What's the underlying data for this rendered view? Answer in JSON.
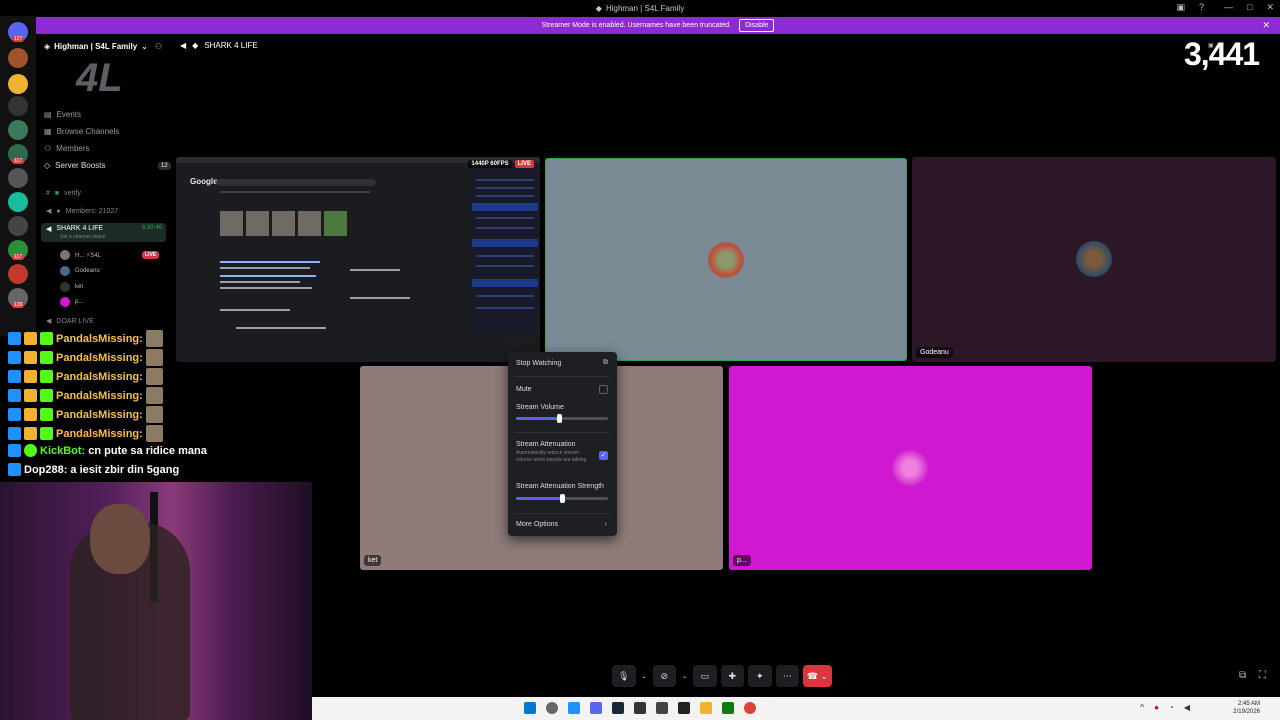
{
  "window": {
    "title": "Highman | S4L Family"
  },
  "banner": {
    "text": "Streamer Mode is enabled. Usernames have been truncated.",
    "disable_label": "Disable"
  },
  "server_rail": {
    "badges": [
      "127",
      "117",
      "117",
      "129"
    ]
  },
  "sidebar": {
    "server_name": "Highman | S4L Family",
    "logo_text": "4L",
    "nav": [
      {
        "label": "Events"
      },
      {
        "label": "Browse Channels"
      },
      {
        "label": "Members"
      },
      {
        "label": "Server Boosts",
        "count": "12"
      }
    ],
    "channels": {
      "verify": "verify",
      "members_count": "Members: 21027",
      "active_name": "SHARK 4 LIFE",
      "active_timer": "6:30:46",
      "active_status": "Set a channel status",
      "members": [
        {
          "name": "H... ⚡S4L",
          "live": "LIVE"
        },
        {
          "name": "Godeanu"
        },
        {
          "name": "ket"
        },
        {
          "name": "p..."
        }
      ],
      "doar_live": "DOAR LIVE"
    }
  },
  "header": {
    "channel_name": "SHARK 4 LIFE"
  },
  "overlay": {
    "viewer_count": "3,441"
  },
  "stream": {
    "quality": "1440P 60FPS",
    "live": "LIVE",
    "google": "Google"
  },
  "tiles": {
    "godeanu": "Godeanu",
    "ket": "ket",
    "p": "p..."
  },
  "menu": {
    "stop_watching": "Stop Watching",
    "mute": "Mute",
    "stream_volume": "Stream Volume",
    "stream_volume_value": 0.47,
    "stream_attenuation": "Stream Attenuation",
    "attenuation_desc": "Automatically reduce stream volume when people are talking.",
    "attenuation_checked": true,
    "attenuation_strength": "Stream Attenuation Strength",
    "attenuation_strength_value": 0.5,
    "more_options": "More Options"
  },
  "chat": [
    {
      "nick": "PandalsMissing:",
      "msg": ""
    },
    {
      "nick": "PandalsMissing:",
      "msg": ""
    },
    {
      "nick": "PandalsMissing:",
      "msg": ""
    },
    {
      "nick": "PandalsMissing:",
      "msg": ""
    },
    {
      "nick": "PandalsMissing:",
      "msg": ""
    },
    {
      "nick": "PandalsMissing:",
      "msg": ""
    },
    {
      "nick": "KickBot:",
      "msg": "cn pute sa ridice mana"
    },
    {
      "nick": "Dop288:",
      "msg": "a iesit zbir din 5gang"
    }
  ],
  "taskbar": {
    "time": "2:45 AM",
    "date": "2/19/2026"
  },
  "colors": {
    "banner": "#8c2bd6",
    "tile_magenta": "#cf18d0",
    "hangup": "#da373c",
    "accent": "#5865f2"
  }
}
